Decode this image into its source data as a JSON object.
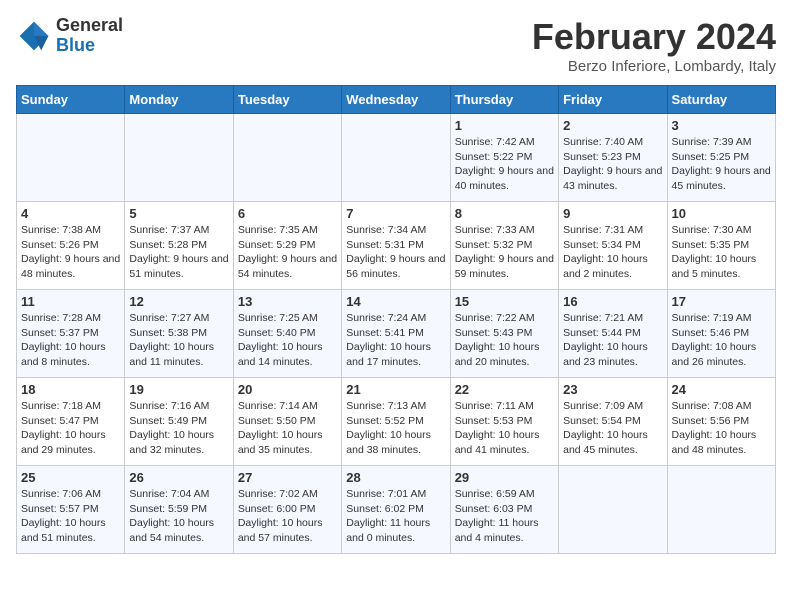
{
  "header": {
    "logo_general": "General",
    "logo_blue": "Blue",
    "month_title": "February 2024",
    "subtitle": "Berzo Inferiore, Lombardy, Italy"
  },
  "weekdays": [
    "Sunday",
    "Monday",
    "Tuesday",
    "Wednesday",
    "Thursday",
    "Friday",
    "Saturday"
  ],
  "weeks": [
    [
      {
        "day": "",
        "info": ""
      },
      {
        "day": "",
        "info": ""
      },
      {
        "day": "",
        "info": ""
      },
      {
        "day": "",
        "info": ""
      },
      {
        "day": "1",
        "info": "Sunrise: 7:42 AM\nSunset: 5:22 PM\nDaylight: 9 hours\nand 40 minutes."
      },
      {
        "day": "2",
        "info": "Sunrise: 7:40 AM\nSunset: 5:23 PM\nDaylight: 9 hours\nand 43 minutes."
      },
      {
        "day": "3",
        "info": "Sunrise: 7:39 AM\nSunset: 5:25 PM\nDaylight: 9 hours\nand 45 minutes."
      }
    ],
    [
      {
        "day": "4",
        "info": "Sunrise: 7:38 AM\nSunset: 5:26 PM\nDaylight: 9 hours\nand 48 minutes."
      },
      {
        "day": "5",
        "info": "Sunrise: 7:37 AM\nSunset: 5:28 PM\nDaylight: 9 hours\nand 51 minutes."
      },
      {
        "day": "6",
        "info": "Sunrise: 7:35 AM\nSunset: 5:29 PM\nDaylight: 9 hours\nand 54 minutes."
      },
      {
        "day": "7",
        "info": "Sunrise: 7:34 AM\nSunset: 5:31 PM\nDaylight: 9 hours\nand 56 minutes."
      },
      {
        "day": "8",
        "info": "Sunrise: 7:33 AM\nSunset: 5:32 PM\nDaylight: 9 hours\nand 59 minutes."
      },
      {
        "day": "9",
        "info": "Sunrise: 7:31 AM\nSunset: 5:34 PM\nDaylight: 10 hours\nand 2 minutes."
      },
      {
        "day": "10",
        "info": "Sunrise: 7:30 AM\nSunset: 5:35 PM\nDaylight: 10 hours\nand 5 minutes."
      }
    ],
    [
      {
        "day": "11",
        "info": "Sunrise: 7:28 AM\nSunset: 5:37 PM\nDaylight: 10 hours\nand 8 minutes."
      },
      {
        "day": "12",
        "info": "Sunrise: 7:27 AM\nSunset: 5:38 PM\nDaylight: 10 hours\nand 11 minutes."
      },
      {
        "day": "13",
        "info": "Sunrise: 7:25 AM\nSunset: 5:40 PM\nDaylight: 10 hours\nand 14 minutes."
      },
      {
        "day": "14",
        "info": "Sunrise: 7:24 AM\nSunset: 5:41 PM\nDaylight: 10 hours\nand 17 minutes."
      },
      {
        "day": "15",
        "info": "Sunrise: 7:22 AM\nSunset: 5:43 PM\nDaylight: 10 hours\nand 20 minutes."
      },
      {
        "day": "16",
        "info": "Sunrise: 7:21 AM\nSunset: 5:44 PM\nDaylight: 10 hours\nand 23 minutes."
      },
      {
        "day": "17",
        "info": "Sunrise: 7:19 AM\nSunset: 5:46 PM\nDaylight: 10 hours\nand 26 minutes."
      }
    ],
    [
      {
        "day": "18",
        "info": "Sunrise: 7:18 AM\nSunset: 5:47 PM\nDaylight: 10 hours\nand 29 minutes."
      },
      {
        "day": "19",
        "info": "Sunrise: 7:16 AM\nSunset: 5:49 PM\nDaylight: 10 hours\nand 32 minutes."
      },
      {
        "day": "20",
        "info": "Sunrise: 7:14 AM\nSunset: 5:50 PM\nDaylight: 10 hours\nand 35 minutes."
      },
      {
        "day": "21",
        "info": "Sunrise: 7:13 AM\nSunset: 5:52 PM\nDaylight: 10 hours\nand 38 minutes."
      },
      {
        "day": "22",
        "info": "Sunrise: 7:11 AM\nSunset: 5:53 PM\nDaylight: 10 hours\nand 41 minutes."
      },
      {
        "day": "23",
        "info": "Sunrise: 7:09 AM\nSunset: 5:54 PM\nDaylight: 10 hours\nand 45 minutes."
      },
      {
        "day": "24",
        "info": "Sunrise: 7:08 AM\nSunset: 5:56 PM\nDaylight: 10 hours\nand 48 minutes."
      }
    ],
    [
      {
        "day": "25",
        "info": "Sunrise: 7:06 AM\nSunset: 5:57 PM\nDaylight: 10 hours\nand 51 minutes."
      },
      {
        "day": "26",
        "info": "Sunrise: 7:04 AM\nSunset: 5:59 PM\nDaylight: 10 hours\nand 54 minutes."
      },
      {
        "day": "27",
        "info": "Sunrise: 7:02 AM\nSunset: 6:00 PM\nDaylight: 10 hours\nand 57 minutes."
      },
      {
        "day": "28",
        "info": "Sunrise: 7:01 AM\nSunset: 6:02 PM\nDaylight: 11 hours\nand 0 minutes."
      },
      {
        "day": "29",
        "info": "Sunrise: 6:59 AM\nSunset: 6:03 PM\nDaylight: 11 hours\nand 4 minutes."
      },
      {
        "day": "",
        "info": ""
      },
      {
        "day": "",
        "info": ""
      }
    ]
  ]
}
